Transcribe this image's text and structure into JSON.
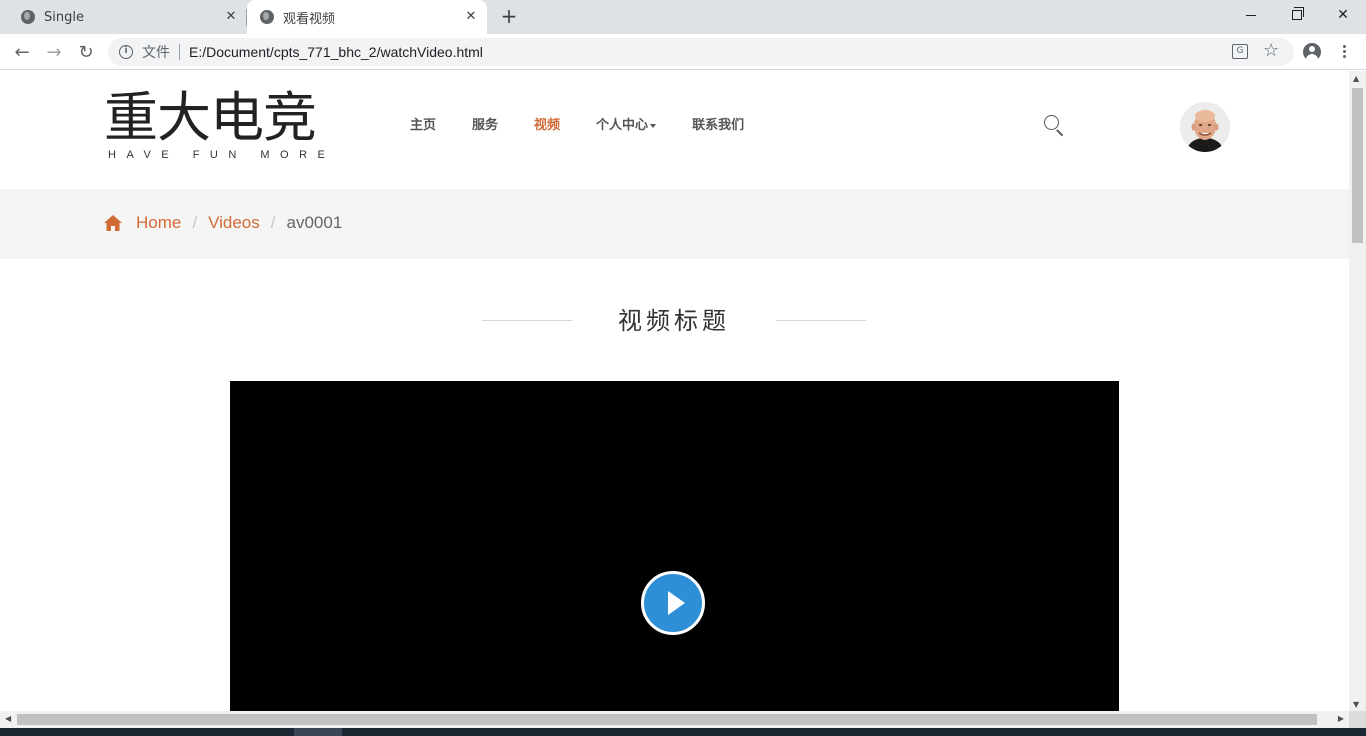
{
  "browser": {
    "tabs": [
      {
        "title": "Single"
      },
      {
        "title": "观看视频"
      }
    ],
    "omnibox": {
      "file_label": "文件",
      "url": "E:/Document/cpts_771_bhc_2/watchVideo.html"
    }
  },
  "site": {
    "logo_cn": "重大电竞",
    "logo_en": "HAVE FUN MORE",
    "nav": [
      {
        "label": "主页"
      },
      {
        "label": "服务"
      },
      {
        "label": "视频",
        "active": true
      },
      {
        "label": "个人中心",
        "has_dropdown": true
      },
      {
        "label": "联系我们"
      }
    ],
    "accent_color": "#d16b36"
  },
  "breadcrumb": {
    "items": [
      "Home",
      "Videos"
    ],
    "current": "av0001",
    "separator": "/"
  },
  "video": {
    "title": "视频标题",
    "play_button_color": "#2f8fd6"
  }
}
